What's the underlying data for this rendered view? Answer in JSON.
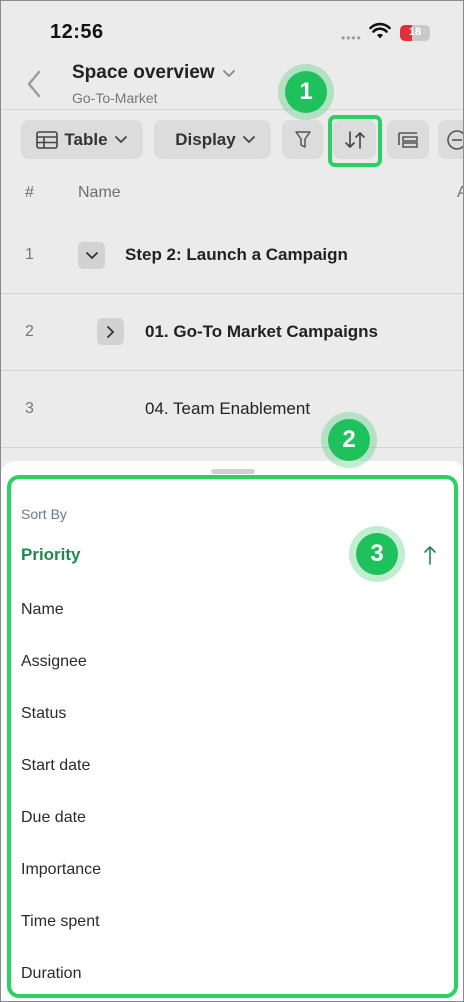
{
  "status_bar": {
    "time": "12:56",
    "battery": "18",
    "battery_color": "#e0313a"
  },
  "header": {
    "title": "Space overview",
    "subtitle": "Go-To-Market"
  },
  "toolbar": {
    "view_label": "Table",
    "display_label": "Display"
  },
  "table": {
    "columns": [
      "#",
      "Name",
      "A"
    ],
    "rows": [
      {
        "num": "1",
        "title": "Step 2: Launch a Campaign",
        "expander": "expanded"
      },
      {
        "num": "2",
        "title": "01. Go-To Market Campaigns",
        "expander": "collapsed"
      },
      {
        "num": "3",
        "title": "04. Team Enablement",
        "expander": "none"
      }
    ]
  },
  "sort_sheet": {
    "heading": "Sort By",
    "selected": "Priority",
    "direction_icon": "arrow-up-icon",
    "options": [
      "Priority",
      "Name",
      "Assignee",
      "Status",
      "Start date",
      "Due date",
      "Importance",
      "Time spent",
      "Duration"
    ]
  },
  "callouts": [
    "1",
    "2",
    "3"
  ],
  "colors": {
    "accent": "#1fc15c",
    "highlight": "#2bd165",
    "selected_text": "#1e8a4f"
  }
}
